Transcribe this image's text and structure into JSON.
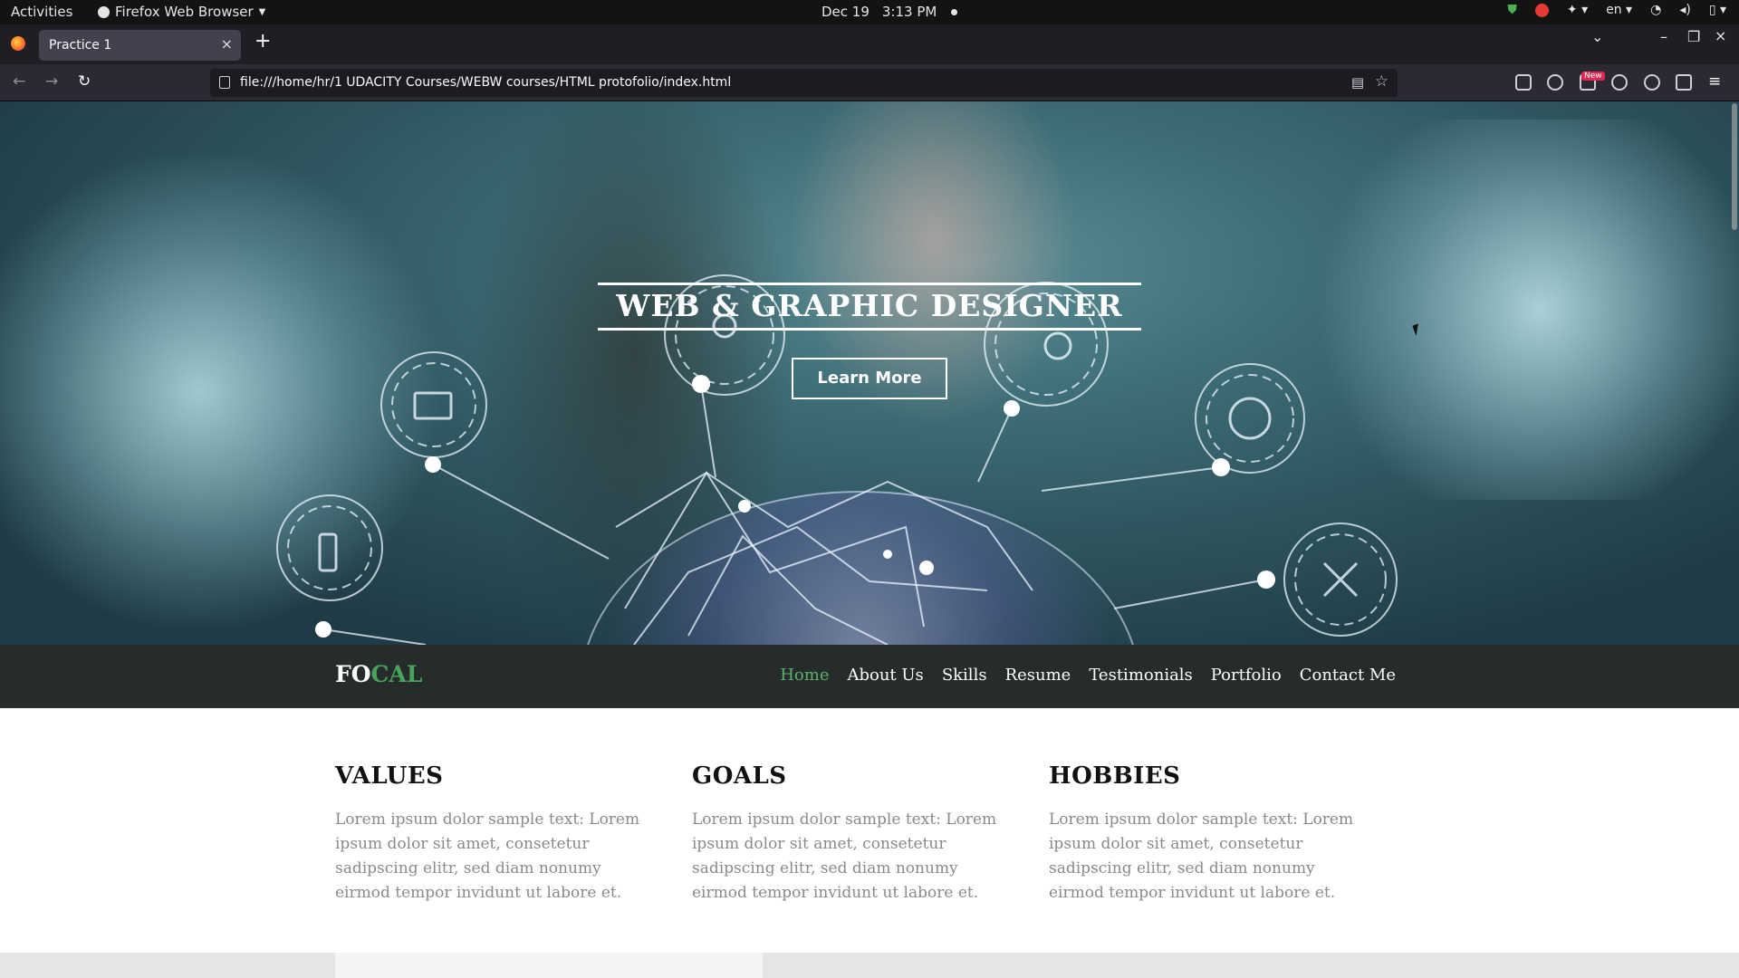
{
  "system_bar": {
    "activities": "Activities",
    "app_name": "Firefox Web Browser",
    "date": "Dec 19",
    "time": "3:13 PM",
    "language": "en"
  },
  "browser": {
    "tab_title": "Practice 1",
    "url": "file:///home/hr/1 UDACITY Courses/WEBW courses/HTML protofolio/index.html",
    "new_badge": "New"
  },
  "hero": {
    "title": "WEB & GRAPHIC DESIGNER",
    "button_label": "Learn More"
  },
  "site_nav": {
    "logo_part1": "FO",
    "logo_part2": "CAL",
    "items": [
      {
        "label": "Home",
        "active": true
      },
      {
        "label": "About Us"
      },
      {
        "label": "Skills"
      },
      {
        "label": "Resume"
      },
      {
        "label": "Testimonials"
      },
      {
        "label": "Portfolio"
      },
      {
        "label": "Contact Me"
      }
    ],
    "accent_color": "#5cb16b"
  },
  "sections": [
    {
      "heading": "VALUES",
      "text": "Lorem ipsum dolor sample text: Lorem ipsum dolor sit amet, consetetur sadipscing elitr, sed diam nonumy eirmod tempor invidunt ut labore et."
    },
    {
      "heading": "GOALS",
      "text": "Lorem ipsum dolor sample text: Lorem ipsum dolor sit amet, consetetur sadipscing elitr, sed diam nonumy eirmod tempor invidunt ut labore et."
    },
    {
      "heading": "HOBBIES",
      "text": "Lorem ipsum dolor sample text: Lorem ipsum dolor sit amet, consetetur sadipscing elitr, sed diam nonumy eirmod tempor invidunt ut labore et."
    }
  ]
}
